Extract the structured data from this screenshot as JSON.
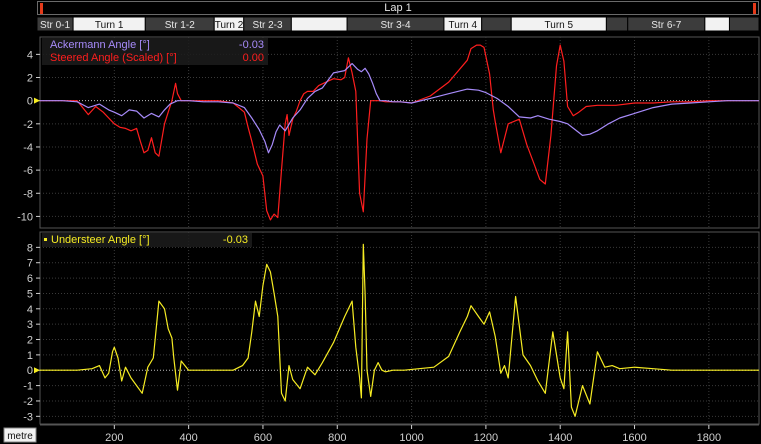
{
  "lap": {
    "label": "Lap 1"
  },
  "sectors": [
    {
      "label": "Str 0-1",
      "kind": "dark",
      "x0": 0,
      "x1": 110
    },
    {
      "label": "Turn 1",
      "kind": "light",
      "x0": 110,
      "x1": 330
    },
    {
      "label": "Str 1-2",
      "kind": "dark",
      "x0": 330,
      "x1": 540
    },
    {
      "label": "Turn 2",
      "kind": "light",
      "x0": 540,
      "x1": 630
    },
    {
      "label": "Str 2-3",
      "kind": "dark",
      "x0": 630,
      "x1": 775
    },
    {
      "label": "",
      "kind": "light",
      "x0": 775,
      "x1": 945
    },
    {
      "label": "Str 3-4",
      "kind": "dark",
      "x0": 945,
      "x1": 1240
    },
    {
      "label": "Turn 4",
      "kind": "light",
      "x0": 1240,
      "x1": 1355
    },
    {
      "label": "",
      "kind": "dark",
      "x0": 1355,
      "x1": 1445
    },
    {
      "label": "Turn 5",
      "kind": "light",
      "x0": 1445,
      "x1": 1735
    },
    {
      "label": "",
      "kind": "dark",
      "x0": 1735,
      "x1": 1800
    },
    {
      "label": "Str 6-7",
      "kind": "dark",
      "x0": 1800,
      "x1": 2035
    },
    {
      "label": "",
      "kind": "light",
      "x0": 2035,
      "x1": 2110
    },
    {
      "label": "",
      "kind": "dark",
      "x0": 2110,
      "x1": 2200
    }
  ],
  "xaxis": {
    "unit": "metre",
    "ticks": [
      200,
      400,
      600,
      800,
      1000,
      1200,
      1400,
      1600,
      1800
    ]
  },
  "colors": {
    "ackermann": "#a78bfa",
    "steered": "#ff1e1e",
    "understeer": "#f6ec23",
    "grid": "#3a3a3a",
    "zero": "#bdbdbd",
    "axis": "#d0d0d0"
  },
  "chart_data": [
    {
      "type": "line",
      "xlim": [
        0,
        1935
      ],
      "ylim": [
        -11,
        5.5
      ],
      "yticks": [
        4,
        2,
        0,
        -2,
        -4,
        -6,
        -8,
        -10
      ],
      "grid": true,
      "legend_position": "top-left",
      "series": [
        {
          "name": "Ackermann Angle [°]",
          "readout": "-0.03",
          "x": [
            0,
            60,
            100,
            130,
            160,
            185,
            200,
            220,
            240,
            260,
            280,
            300,
            320,
            335,
            350,
            370,
            400,
            440,
            480,
            520,
            550,
            570,
            590,
            605,
            615,
            625,
            635,
            645,
            660,
            680,
            700,
            720,
            740,
            760,
            790,
            820,
            840,
            855,
            865,
            875,
            885,
            895,
            905,
            915,
            930,
            950,
            970,
            1000,
            1050,
            1100,
            1150,
            1180,
            1200,
            1230,
            1260,
            1290,
            1320,
            1340,
            1370,
            1400,
            1420,
            1440,
            1460,
            1480,
            1500,
            1530,
            1560,
            1600,
            1650,
            1700,
            1750,
            1800,
            1850,
            1900,
            1935
          ],
          "y": [
            0,
            0,
            -0.1,
            -0.6,
            -0.3,
            -0.8,
            -1,
            -1.3,
            -0.8,
            -0.9,
            -1.5,
            -1.1,
            -1.4,
            -0.8,
            -0.3,
            0,
            0,
            -0.1,
            -0.1,
            -0.2,
            -0.6,
            -1.5,
            -2.5,
            -3.5,
            -4.5,
            -3.8,
            -2.7,
            -2.1,
            -2.6,
            -1.5,
            -0.8,
            0.2,
            0.8,
            1.1,
            2.4,
            2.6,
            3.2,
            2.7,
            2.5,
            2.8,
            2.3,
            1.5,
            0.6,
            0,
            0,
            -0.1,
            -0.1,
            -0.2,
            0.2,
            0.6,
            1,
            0.9,
            0.7,
            0.2,
            -0.5,
            -1.4,
            -1.5,
            -1.3,
            -1.6,
            -1.8,
            -2,
            -2.5,
            -3,
            -2.9,
            -2.6,
            -2,
            -1.5,
            -1.1,
            -0.6,
            -0.3,
            -0.2,
            -0.1,
            0,
            0,
            0
          ]
        },
        {
          "name": "Steered Angle (Scaled) [°]",
          "readout": "0.00",
          "x": [
            0,
            60,
            100,
            115,
            130,
            150,
            170,
            185,
            200,
            215,
            230,
            245,
            260,
            270,
            280,
            290,
            300,
            310,
            320,
            335,
            345,
            355,
            365,
            370,
            380,
            400,
            440,
            480,
            520,
            550,
            560,
            570,
            585,
            600,
            610,
            620,
            630,
            640,
            650,
            660,
            665,
            670,
            680,
            690,
            700,
            710,
            720,
            735,
            750,
            770,
            790,
            810,
            820,
            830,
            840,
            850,
            860,
            870,
            880,
            890,
            900,
            905,
            915,
            930,
            950,
            970,
            1000,
            1050,
            1100,
            1150,
            1160,
            1175,
            1185,
            1195,
            1210,
            1220,
            1225,
            1240,
            1260,
            1290,
            1310,
            1330,
            1345,
            1360,
            1375,
            1390,
            1400,
            1410,
            1420,
            1435,
            1450,
            1470,
            1500,
            1550,
            1600,
            1650,
            1700,
            1750,
            1800,
            1850,
            1900,
            1935
          ],
          "y": [
            0,
            0,
            0,
            -0.6,
            -1.2,
            -0.5,
            -1,
            -1.5,
            -2,
            -2.3,
            -2.4,
            -2.6,
            -2.4,
            -3.5,
            -4.5,
            -4.3,
            -3.2,
            -4.5,
            -4.8,
            -2,
            -1,
            0,
            1.5,
            0.6,
            0,
            0,
            0,
            0,
            -0.2,
            -1,
            -2.3,
            -3.5,
            -5.5,
            -6.5,
            -9.5,
            -10.3,
            -9.8,
            -10.1,
            -6,
            -2,
            -1.2,
            -3,
            -1.6,
            -0.9,
            0,
            0.6,
            0.8,
            0.8,
            1.3,
            1.6,
            1.9,
            1.8,
            2,
            3.7,
            2.4,
            0.8,
            -8,
            -9.6,
            -3.3,
            0,
            0,
            0,
            0,
            -0.1,
            -0.1,
            -0.1,
            -0.2,
            0.4,
            1.6,
            3.5,
            4.5,
            4.8,
            4.8,
            4.6,
            2.3,
            -0.8,
            -1.8,
            -4.5,
            -2,
            -1.6,
            -3.8,
            -5.5,
            -6.8,
            -7.2,
            -3,
            3,
            4.8,
            3.4,
            -0.5,
            -1.3,
            -1,
            -0.5,
            -0.4,
            -0.4,
            -0.2,
            -0.2,
            -0.1,
            -0.1,
            0,
            0,
            0,
            0
          ]
        }
      ]
    },
    {
      "type": "line",
      "xlim": [
        0,
        1935
      ],
      "ylim": [
        -3.5,
        9
      ],
      "yticks": [
        8,
        7,
        6,
        5,
        4,
        3,
        2,
        1,
        0,
        -1,
        -2,
        -3
      ],
      "grid": true,
      "legend_position": "top-left",
      "series": [
        {
          "name": "Understeer Angle [°]",
          "readout": "-0.03",
          "x": [
            0,
            60,
            100,
            140,
            160,
            175,
            185,
            195,
            200,
            210,
            220,
            230,
            245,
            260,
            275,
            290,
            305,
            320,
            335,
            345,
            355,
            360,
            370,
            380,
            400,
            440,
            480,
            520,
            545,
            560,
            570,
            580,
            590,
            600,
            610,
            620,
            630,
            640,
            650,
            660,
            670,
            680,
            700,
            720,
            740,
            760,
            790,
            820,
            840,
            850,
            860,
            865,
            870,
            875,
            880,
            890,
            900,
            910,
            920,
            930,
            950,
            980,
            1020,
            1060,
            1100,
            1130,
            1150,
            1160,
            1180,
            1195,
            1210,
            1225,
            1240,
            1250,
            1260,
            1280,
            1300,
            1320,
            1340,
            1360,
            1380,
            1400,
            1410,
            1420,
            1430,
            1440,
            1460,
            1480,
            1500,
            1520,
            1540,
            1560,
            1600,
            1650,
            1700,
            1750,
            1800,
            1850,
            1900,
            1935
          ],
          "y": [
            0,
            0,
            0,
            0.1,
            0.3,
            -0.5,
            -0.2,
            1.2,
            1.5,
            0.8,
            -0.7,
            0.2,
            -0.5,
            -1,
            -1.5,
            0.2,
            0.8,
            4.5,
            4,
            2.7,
            2.1,
            0.8,
            -1.3,
            0.6,
            0,
            0,
            0,
            0,
            0.3,
            0.8,
            2.5,
            4.5,
            3.5,
            5.5,
            6.9,
            6.4,
            5,
            3.5,
            -1.5,
            -2,
            0.3,
            -0.6,
            -1.2,
            0.2,
            -0.3,
            0.5,
            1.8,
            3.5,
            4.5,
            1.5,
            -0.5,
            -1.8,
            8.2,
            5,
            0,
            -1.7,
            0,
            0.5,
            0,
            -0.1,
            0,
            0,
            0.1,
            0.2,
            0.9,
            2.5,
            3.5,
            4.2,
            3.5,
            3,
            3.8,
            2.2,
            -0.2,
            0.3,
            -0.5,
            4.8,
            1,
            0.3,
            -0.7,
            -1.5,
            2.5,
            -0.5,
            -1.2,
            2.5,
            -2.4,
            -3,
            -1,
            -2.2,
            1.2,
            0.2,
            0.3,
            0.1,
            0.2,
            0.1,
            0,
            0,
            0,
            0,
            0,
            0
          ]
        }
      ]
    }
  ]
}
